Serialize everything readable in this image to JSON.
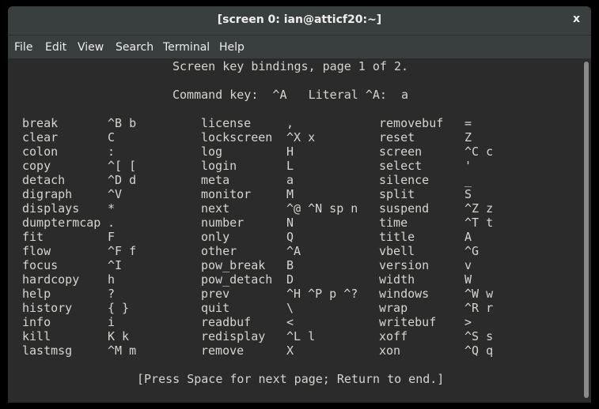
{
  "window": {
    "title": "[screen 0: ian@atticf20:~]",
    "close_label": "x"
  },
  "menu": [
    "File",
    "Edit",
    "View",
    "Search",
    "Terminal",
    "Help"
  ],
  "terminal": {
    "header": "Screen key bindings, page 1 of 2.",
    "command_line": "Command key:  ^A   Literal ^A:  a",
    "bindings": [
      [
        [
          "break",
          "^B b"
        ],
        [
          "license",
          ","
        ],
        [
          "removebuf",
          "="
        ]
      ],
      [
        [
          "clear",
          "C"
        ],
        [
          "lockscreen",
          "^X x"
        ],
        [
          "reset",
          "Z"
        ]
      ],
      [
        [
          "colon",
          ":"
        ],
        [
          "log",
          "H"
        ],
        [
          "screen",
          "^C c"
        ]
      ],
      [
        [
          "copy",
          "^[ ["
        ],
        [
          "login",
          "L"
        ],
        [
          "select",
          "'"
        ]
      ],
      [
        [
          "detach",
          "^D d"
        ],
        [
          "meta",
          "a"
        ],
        [
          "silence",
          "_"
        ]
      ],
      [
        [
          "digraph",
          "^V"
        ],
        [
          "monitor",
          "M"
        ],
        [
          "split",
          "S"
        ]
      ],
      [
        [
          "displays",
          "*"
        ],
        [
          "next",
          "^@ ^N sp n"
        ],
        [
          "suspend",
          "^Z z"
        ]
      ],
      [
        [
          "dumptermcap",
          "."
        ],
        [
          "number",
          "N"
        ],
        [
          "time",
          "^T t"
        ]
      ],
      [
        [
          "fit",
          "F"
        ],
        [
          "only",
          "Q"
        ],
        [
          "title",
          "A"
        ]
      ],
      [
        [
          "flow",
          "^F f"
        ],
        [
          "other",
          "^A"
        ],
        [
          "vbell",
          "^G"
        ]
      ],
      [
        [
          "focus",
          "^I"
        ],
        [
          "pow_break",
          "B"
        ],
        [
          "version",
          "v"
        ]
      ],
      [
        [
          "hardcopy",
          "h"
        ],
        [
          "pow_detach",
          "D"
        ],
        [
          "width",
          "W"
        ]
      ],
      [
        [
          "help",
          "?"
        ],
        [
          "prev",
          "^H ^P p ^?"
        ],
        [
          "windows",
          "^W w"
        ]
      ],
      [
        [
          "history",
          "{ }"
        ],
        [
          "quit",
          "\\"
        ],
        [
          "wrap",
          "^R r"
        ]
      ],
      [
        [
          "info",
          "i"
        ],
        [
          "readbuf",
          "<"
        ],
        [
          "writebuf",
          ">"
        ]
      ],
      [
        [
          "kill",
          "K k"
        ],
        [
          "redisplay",
          "^L l"
        ],
        [
          "xoff",
          "^S s"
        ]
      ],
      [
        [
          "lastmsg",
          "^M m"
        ],
        [
          "remove",
          "X"
        ],
        [
          "xon",
          "^Q q"
        ]
      ]
    ],
    "footer": "[Press Space for next page; Return to end.]"
  }
}
